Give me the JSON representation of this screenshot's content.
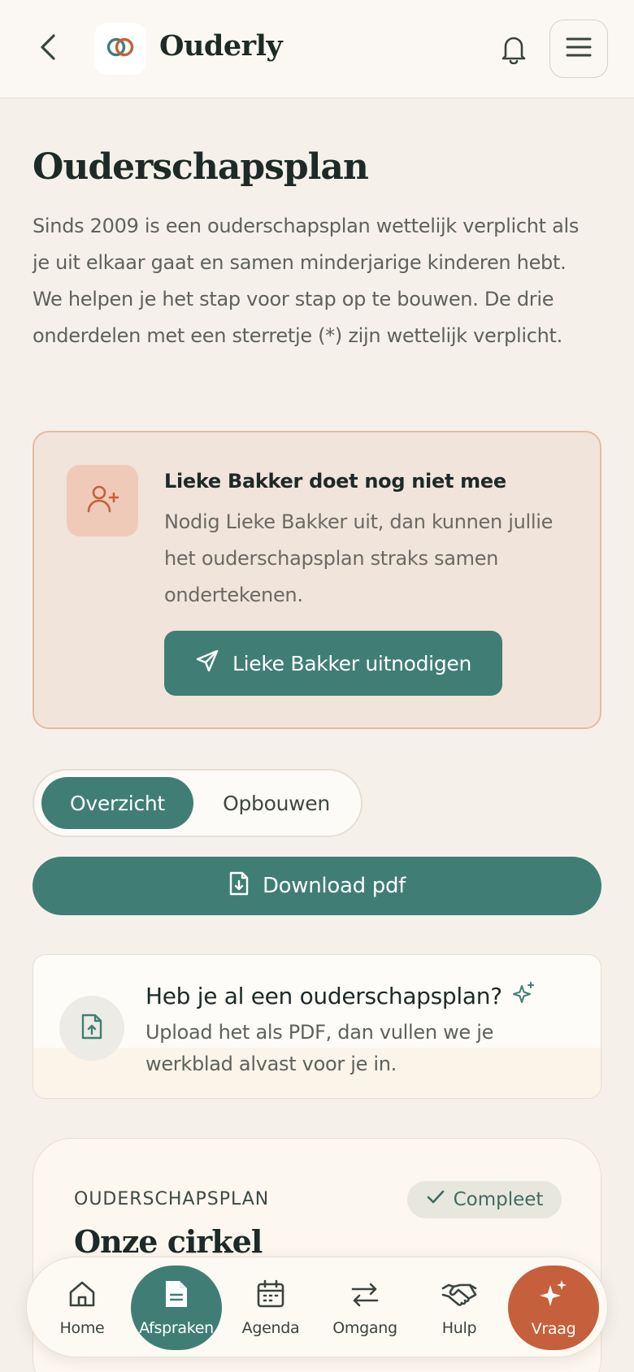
{
  "header": {
    "brand": "Ouderly",
    "icons": {
      "back": "chevron-left-icon",
      "logo": "interlocking-rings-icon",
      "bell": "bell-icon",
      "menu": "hamburger-menu-icon"
    }
  },
  "page": {
    "title": "Ouderschapsplan",
    "intro": "Sinds 2009 is een ouderschapsplan wettelijk verplicht als je uit elkaar gaat en samen minderjarige kinderen hebt. We helpen je het stap voor stap op te bouwen. De drie onderdelen met een sterretje (*) zijn wettelijk verplicht."
  },
  "invite": {
    "title": "Lieke Bakker doet nog niet mee",
    "text": "Nodig Lieke Bakker uit, dan kunnen jullie het ouderschapsplan straks samen ondertekenen.",
    "button_label": "Lieke Bakker uitnodigen",
    "icon": "user-plus-icon"
  },
  "tabs": {
    "items": [
      {
        "label": "Overzicht",
        "active": true
      },
      {
        "label": "Opbouwen",
        "active": false
      }
    ]
  },
  "download": {
    "label": "Download pdf",
    "icon": "file-download-icon"
  },
  "upload": {
    "title": "Heb je al een ouderschapsplan?",
    "text": "Upload het als PDF, dan vullen we je werkblad alvast voor je in.",
    "icon": "file-upload-icon",
    "sparkle": "sparkle-icon"
  },
  "plan": {
    "eyebrow": "OUDERSCHAPSPLAN",
    "badge": "Compleet",
    "title": "Onze cirkel"
  },
  "nav": {
    "items": [
      {
        "label": "Home",
        "icon": "home-icon"
      },
      {
        "label": "Afspraken",
        "icon": "document-icon",
        "active": true
      },
      {
        "label": "Agenda",
        "icon": "calendar-icon"
      },
      {
        "label": "Omgang",
        "icon": "arrows-swap-icon"
      },
      {
        "label": "Hulp",
        "icon": "handshake-icon"
      },
      {
        "label": "Vraag",
        "icon": "sparkle-icon"
      }
    ]
  },
  "colors": {
    "primary": "#407e75",
    "accent": "#c65f3b",
    "background": "#f5f1ea",
    "invite_bg": "#f1e4da"
  }
}
